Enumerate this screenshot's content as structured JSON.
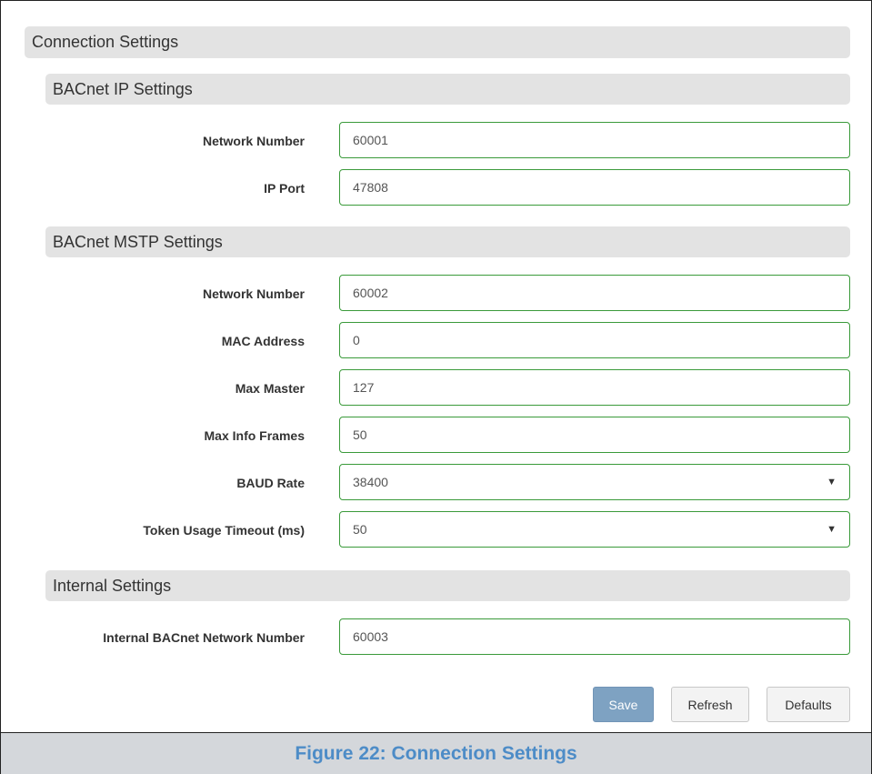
{
  "main_header": "Connection Settings",
  "ip_section": {
    "title": "BACnet IP Settings",
    "network_number_label": "Network Number",
    "network_number_value": "60001",
    "ip_port_label": "IP Port",
    "ip_port_value": "47808"
  },
  "mstp_section": {
    "title": "BACnet MSTP Settings",
    "network_number_label": "Network Number",
    "network_number_value": "60002",
    "mac_address_label": "MAC Address",
    "mac_address_value": "0",
    "max_master_label": "Max Master",
    "max_master_value": "127",
    "max_info_frames_label": "Max Info Frames",
    "max_info_frames_value": "50",
    "baud_rate_label": "BAUD Rate",
    "baud_rate_value": "38400",
    "token_timeout_label": "Token Usage Timeout (ms)",
    "token_timeout_value": "50"
  },
  "internal_section": {
    "title": "Internal Settings",
    "internal_network_label": "Internal BACnet Network Number",
    "internal_network_value": "60003"
  },
  "buttons": {
    "save": "Save",
    "refresh": "Refresh",
    "defaults": "Defaults"
  },
  "caption": "Figure 22: Connection Settings",
  "colors": {
    "field_border": "#3a9a3a",
    "save_button": "#7ea2c2",
    "caption_text": "#4d8cc7"
  }
}
